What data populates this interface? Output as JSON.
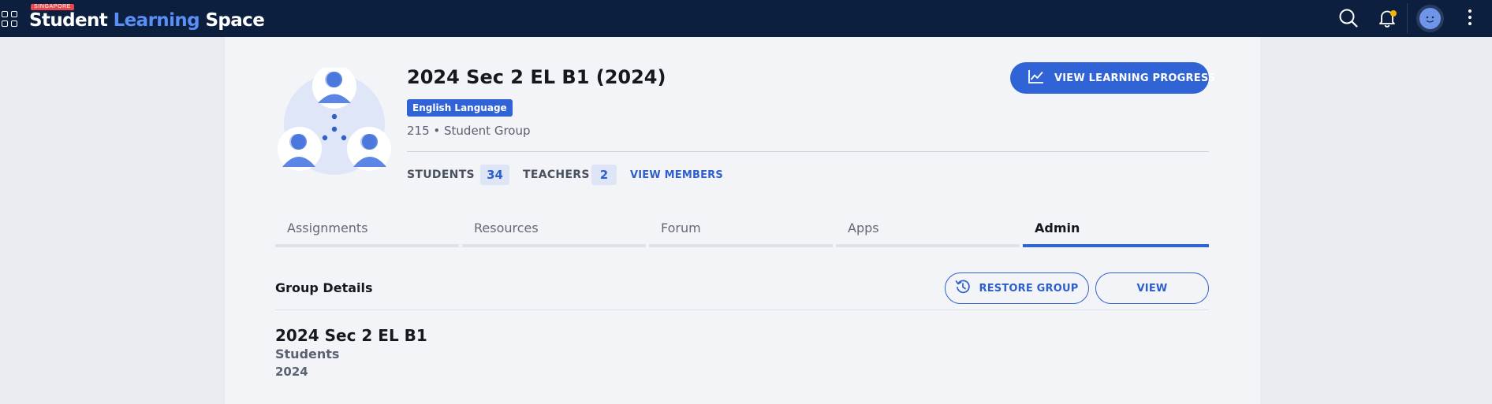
{
  "topbar": {
    "brand_tag": "SINGAPORE",
    "brand_word1": "Student",
    "brand_word2": "Learning",
    "brand_word3": "Space",
    "icons": [
      "apps-grid-icon",
      "search-icon",
      "notification-bell-icon",
      "user-avatar",
      "more-options-icon"
    ],
    "notification_dot_color": "#f5b400"
  },
  "header": {
    "title": "2024 Sec 2 EL B1 (2024)",
    "subject": "English Language",
    "meta": "215 • Student Group",
    "students_label": "STUDENTS",
    "students_count": "34",
    "teachers_label": "TEACHERS",
    "teachers_count": "2",
    "view_members": "VIEW MEMBERS",
    "progress_button": "VIEW LEARNING PROGRESS"
  },
  "tabs": [
    {
      "label": "Assignments",
      "active": false
    },
    {
      "label": "Resources",
      "active": false
    },
    {
      "label": "Forum",
      "active": false
    },
    {
      "label": "Apps",
      "active": false
    },
    {
      "label": "Admin",
      "active": true
    }
  ],
  "group_details": {
    "section_title": "Group Details",
    "restore_button": "RESTORE GROUP",
    "view_button": "VIEW",
    "name": "2024 Sec 2 EL B1",
    "type": "Students",
    "year": "2024"
  },
  "colors": {
    "nav_bg": "#0c1f3f",
    "accent": "#2f63d6",
    "brand_highlight": "#5b8ff5",
    "page_bg": "#e9ebf0",
    "panel_bg": "#f2f4f8"
  }
}
